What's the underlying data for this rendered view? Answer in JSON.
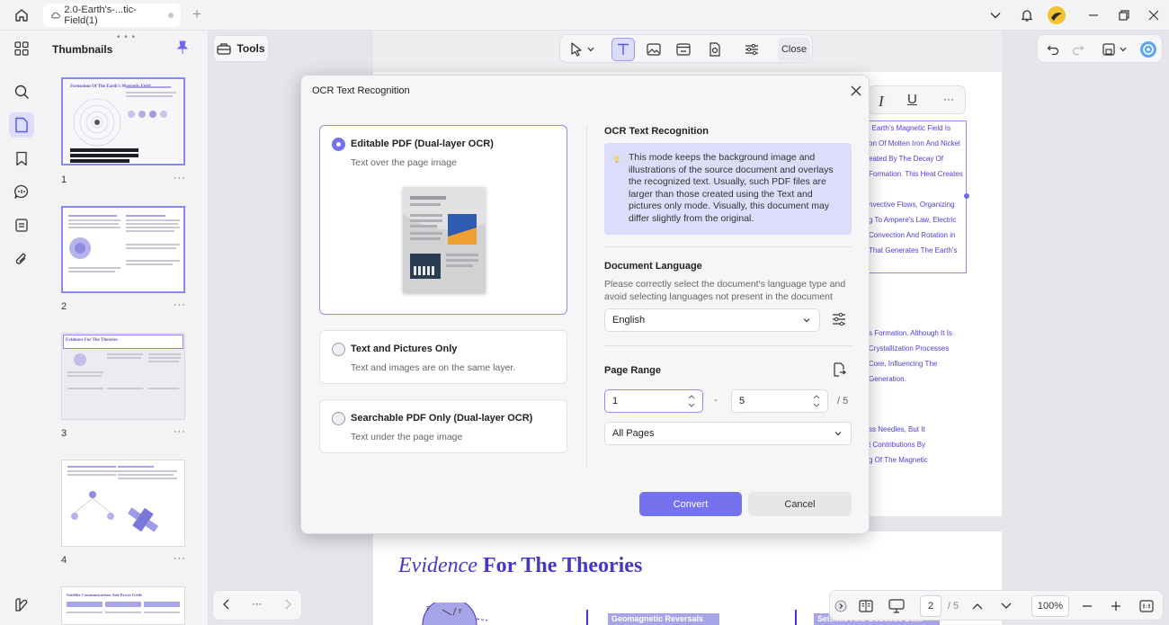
{
  "titlebar": {
    "tab_title": "2.0-Earth's-...tic-Field(1)"
  },
  "thumbnails": {
    "title": "Thumbnails",
    "more": "···",
    "pages": [
      {
        "number": "1",
        "title": "Formation Of The Earth's Magnetic Field"
      },
      {
        "number": "2"
      },
      {
        "number": "3",
        "title": "Evidence For The Theories"
      },
      {
        "number": "4"
      },
      {
        "number": "5",
        "title": "Satellite Communications And Power Grids"
      }
    ]
  },
  "toolbar": {
    "tools_label": "Tools",
    "close_label": "Close"
  },
  "page_text": {
    "lines_top": [
      "e Earth's Magnetic Field Is",
      "on Of Molten Iron And Nickel",
      "eated By The Decay Of",
      "Formation. This Heat Creates",
      "",
      "nvective Flows, Organizing",
      "g To Ampere's Law, Electric",
      "Convection And Rotation in",
      "That Generates The Earth's"
    ],
    "lines_mid": [
      "s Formation. Although It Is",
      "Crystallization Processes",
      "Core, Influencing The",
      "Generation."
    ],
    "lines_low": [
      "ss Needles, But It",
      "t Contributions By",
      "g Of The Magnetic"
    ],
    "heading_italic": "Evidence",
    "heading_bold": "For The Theories",
    "panel_a": "Geomagnetic Reversals",
    "panel_b": "Seismic And Geodetic Data"
  },
  "dialog": {
    "title": "OCR Text Recognition",
    "options": [
      {
        "title": "Editable PDF (Dual-layer OCR)",
        "subtitle": "Text over the page image",
        "selected": true
      },
      {
        "title": "Text and Pictures Only",
        "subtitle": "Text and images are on the same layer.",
        "selected": false
      },
      {
        "title": "Searchable PDF Only (Dual-layer OCR)",
        "subtitle": "Text under the page image",
        "selected": false
      }
    ],
    "right": {
      "section_title": "OCR Text Recognition",
      "info": "This mode keeps the background image and illustrations of the source document and overlays the recognized text. Usually, such PDF files are larger than those created using the Text and pictures only mode. Visually, this document may differ slightly from the original.",
      "lang_title": "Document Language",
      "lang_desc": "Please correctly select the document's language type and avoid selecting languages not present in the document",
      "language": "English",
      "range_title": "Page Range",
      "range_from": "1",
      "range_to": "5",
      "range_sep": "-",
      "range_total": "/ 5",
      "range_mode": "All Pages"
    },
    "convert_label": "Convert",
    "cancel_label": "Cancel"
  },
  "nav": {
    "more": "···",
    "current_page": "2",
    "total_pages": "/ 5",
    "zoom": "100%"
  },
  "colors": {
    "accent": "#7572ee",
    "accent_light": "#dcdcfb",
    "page_text": "#4b3fd8"
  }
}
